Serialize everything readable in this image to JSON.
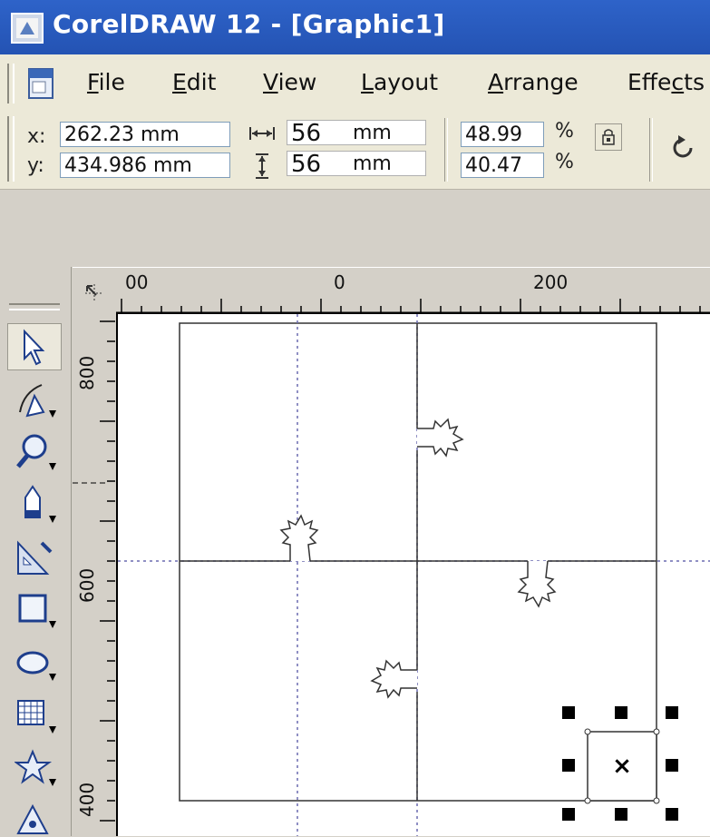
{
  "window": {
    "title": "CorelDRAW 12 - [Graphic1]"
  },
  "menu": {
    "items": [
      "File",
      "Edit",
      "View",
      "Layout",
      "Arrange",
      "Effects"
    ],
    "mnemonics": [
      "F",
      "E",
      "V",
      "L",
      "A",
      "c"
    ]
  },
  "property_bar": {
    "x_label": "x:",
    "x_value": "262.23 mm",
    "y_label": "y:",
    "y_value": "434.986 mm",
    "width_value": "56",
    "width_unit": "mm",
    "height_value": "56",
    "height_unit": "mm",
    "scale_x": "48.99",
    "scale_y": "40.47",
    "percent_symbol": "%"
  },
  "rulers": {
    "horizontal_labels": [
      "00",
      "0",
      "200"
    ],
    "vertical_labels": [
      "800",
      "600",
      "400"
    ]
  },
  "toolbox": {
    "tools": [
      "pick-tool",
      "shape-tool",
      "zoom-tool",
      "freehand-tool",
      "smart-fill-tool",
      "rectangle-tool",
      "ellipse-tool",
      "graph-paper-tool",
      "star-tool",
      "basic-shapes-tool"
    ]
  },
  "selection": {
    "center_marker": "×"
  },
  "colors": {
    "title_bar": "#2453b3",
    "toolbar_bg": "#ece9d8",
    "workspace_bg": "#d4d0c8",
    "guide": "#6b6bb0"
  }
}
